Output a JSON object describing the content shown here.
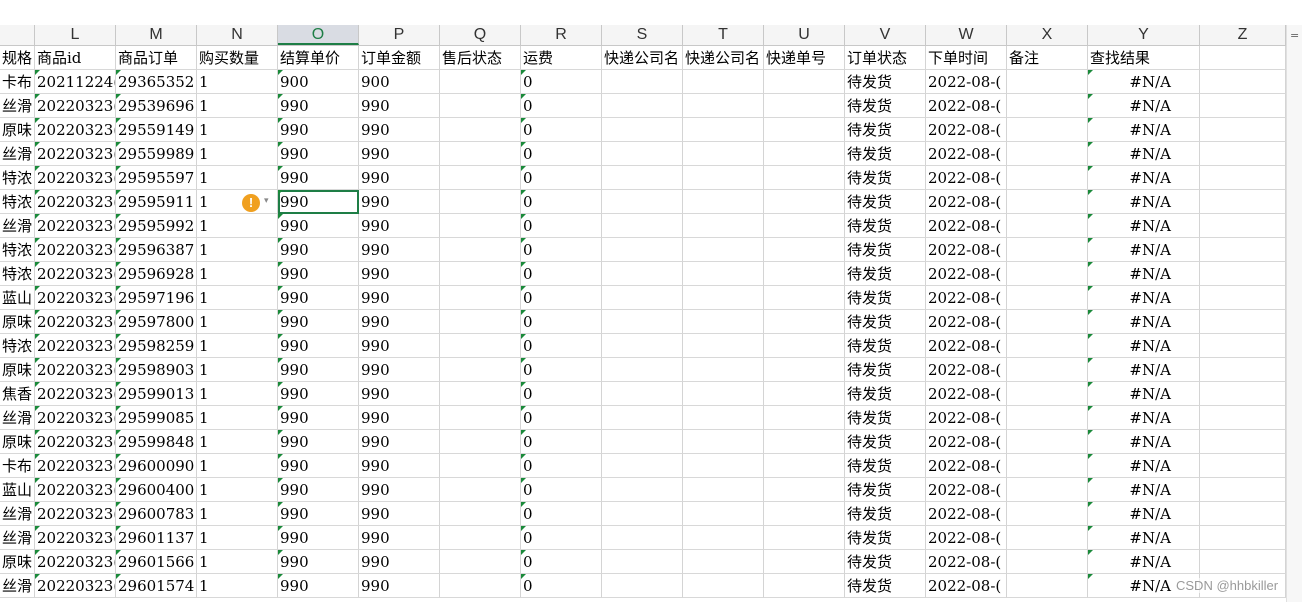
{
  "columns": [
    "",
    "L",
    "M",
    "N",
    "O",
    "P",
    "Q",
    "R",
    "S",
    "T",
    "U",
    "V",
    "W",
    "X",
    "Y",
    "Z"
  ],
  "selected_column": "O",
  "header_row": [
    "规格",
    "商品id",
    "商品订单",
    "购买数量",
    "结算单价",
    "订单金额",
    "售后状态",
    "运费",
    "快递公司名",
    "快递公司名",
    "快递单号",
    "订单状态",
    "下单时间",
    "备注",
    "查找结果",
    ""
  ],
  "rows": [
    [
      "卡布",
      "20211224(",
      "29365352",
      "1",
      "900",
      "900",
      "",
      "0",
      "",
      "",
      "",
      "待发货",
      "2022-08-(",
      "",
      "#N/A",
      ""
    ],
    [
      "丝滑",
      "20220323(",
      "29539696",
      "1",
      "990",
      "990",
      "",
      "0",
      "",
      "",
      "",
      "待发货",
      "2022-08-(",
      "",
      "#N/A",
      ""
    ],
    [
      "原味",
      "20220323(",
      "29559149",
      "1",
      "990",
      "990",
      "",
      "0",
      "",
      "",
      "",
      "待发货",
      "2022-08-(",
      "",
      "#N/A",
      ""
    ],
    [
      "丝滑",
      "20220323(",
      "29559989",
      "1",
      "990",
      "990",
      "",
      "0",
      "",
      "",
      "",
      "待发货",
      "2022-08-(",
      "",
      "#N/A",
      ""
    ],
    [
      "特浓",
      "20220323(",
      "29595597",
      "1",
      "990",
      "990",
      "",
      "0",
      "",
      "",
      "",
      "待发货",
      "2022-08-(",
      "",
      "#N/A",
      ""
    ],
    [
      "特浓",
      "20220323(",
      "29595911",
      "1",
      "990",
      "990",
      "",
      "0",
      "",
      "",
      "",
      "待发货",
      "2022-08-(",
      "",
      "#N/A",
      ""
    ],
    [
      "丝滑",
      "20220323(",
      "29595992",
      "1",
      "990",
      "990",
      "",
      "0",
      "",
      "",
      "",
      "待发货",
      "2022-08-(",
      "",
      "#N/A",
      ""
    ],
    [
      "特浓",
      "20220323(",
      "29596387",
      "1",
      "990",
      "990",
      "",
      "0",
      "",
      "",
      "",
      "待发货",
      "2022-08-(",
      "",
      "#N/A",
      ""
    ],
    [
      "特浓",
      "20220323(",
      "29596928",
      "1",
      "990",
      "990",
      "",
      "0",
      "",
      "",
      "",
      "待发货",
      "2022-08-(",
      "",
      "#N/A",
      ""
    ],
    [
      "蓝山",
      "20220323(",
      "29597196",
      "1",
      "990",
      "990",
      "",
      "0",
      "",
      "",
      "",
      "待发货",
      "2022-08-(",
      "",
      "#N/A",
      ""
    ],
    [
      "原味",
      "20220323(",
      "29597800",
      "1",
      "990",
      "990",
      "",
      "0",
      "",
      "",
      "",
      "待发货",
      "2022-08-(",
      "",
      "#N/A",
      ""
    ],
    [
      "特浓",
      "20220323(",
      "29598259",
      "1",
      "990",
      "990",
      "",
      "0",
      "",
      "",
      "",
      "待发货",
      "2022-08-(",
      "",
      "#N/A",
      ""
    ],
    [
      "原味",
      "20220323(",
      "29598903",
      "1",
      "990",
      "990",
      "",
      "0",
      "",
      "",
      "",
      "待发货",
      "2022-08-(",
      "",
      "#N/A",
      ""
    ],
    [
      "焦香",
      "20220323(",
      "29599013",
      "1",
      "990",
      "990",
      "",
      "0",
      "",
      "",
      "",
      "待发货",
      "2022-08-(",
      "",
      "#N/A",
      ""
    ],
    [
      "丝滑",
      "20220323(",
      "29599085",
      "1",
      "990",
      "990",
      "",
      "0",
      "",
      "",
      "",
      "待发货",
      "2022-08-(",
      "",
      "#N/A",
      ""
    ],
    [
      "原味",
      "20220323(",
      "29599848",
      "1",
      "990",
      "990",
      "",
      "0",
      "",
      "",
      "",
      "待发货",
      "2022-08-(",
      "",
      "#N/A",
      ""
    ],
    [
      "卡布",
      "20220323(",
      "29600090",
      "1",
      "990",
      "990",
      "",
      "0",
      "",
      "",
      "",
      "待发货",
      "2022-08-(",
      "",
      "#N/A",
      ""
    ],
    [
      "蓝山",
      "20220323(",
      "29600400",
      "1",
      "990",
      "990",
      "",
      "0",
      "",
      "",
      "",
      "待发货",
      "2022-08-(",
      "",
      "#N/A",
      ""
    ],
    [
      "丝滑",
      "20220323(",
      "29600783",
      "1",
      "990",
      "990",
      "",
      "0",
      "",
      "",
      "",
      "待发货",
      "2022-08-(",
      "",
      "#N/A",
      ""
    ],
    [
      "丝滑",
      "20220323(",
      "29601137",
      "1",
      "990",
      "990",
      "",
      "0",
      "",
      "",
      "",
      "待发货",
      "2022-08-(",
      "",
      "#N/A",
      ""
    ],
    [
      "原味",
      "20220323(",
      "29601566",
      "1",
      "990",
      "990",
      "",
      "0",
      "",
      "",
      "",
      "待发货",
      "2022-08-(",
      "",
      "#N/A",
      ""
    ],
    [
      "丝滑",
      "20220323(",
      "29601574",
      "1",
      "990",
      "990",
      "",
      "0",
      "",
      "",
      "",
      "待发货",
      "2022-08-(",
      "",
      "#N/A",
      ""
    ]
  ],
  "active_cell": {
    "row": 5,
    "column": "O"
  },
  "warning_icon": "exclamation-circle-icon",
  "warning_symbol": "!",
  "dropdown_glyph": "▾",
  "scrollbar_glyph": "=",
  "watermark": "CSDN @hhbkiller",
  "colors": {
    "accent": "#1e7e46",
    "warning": "#f0a020"
  }
}
